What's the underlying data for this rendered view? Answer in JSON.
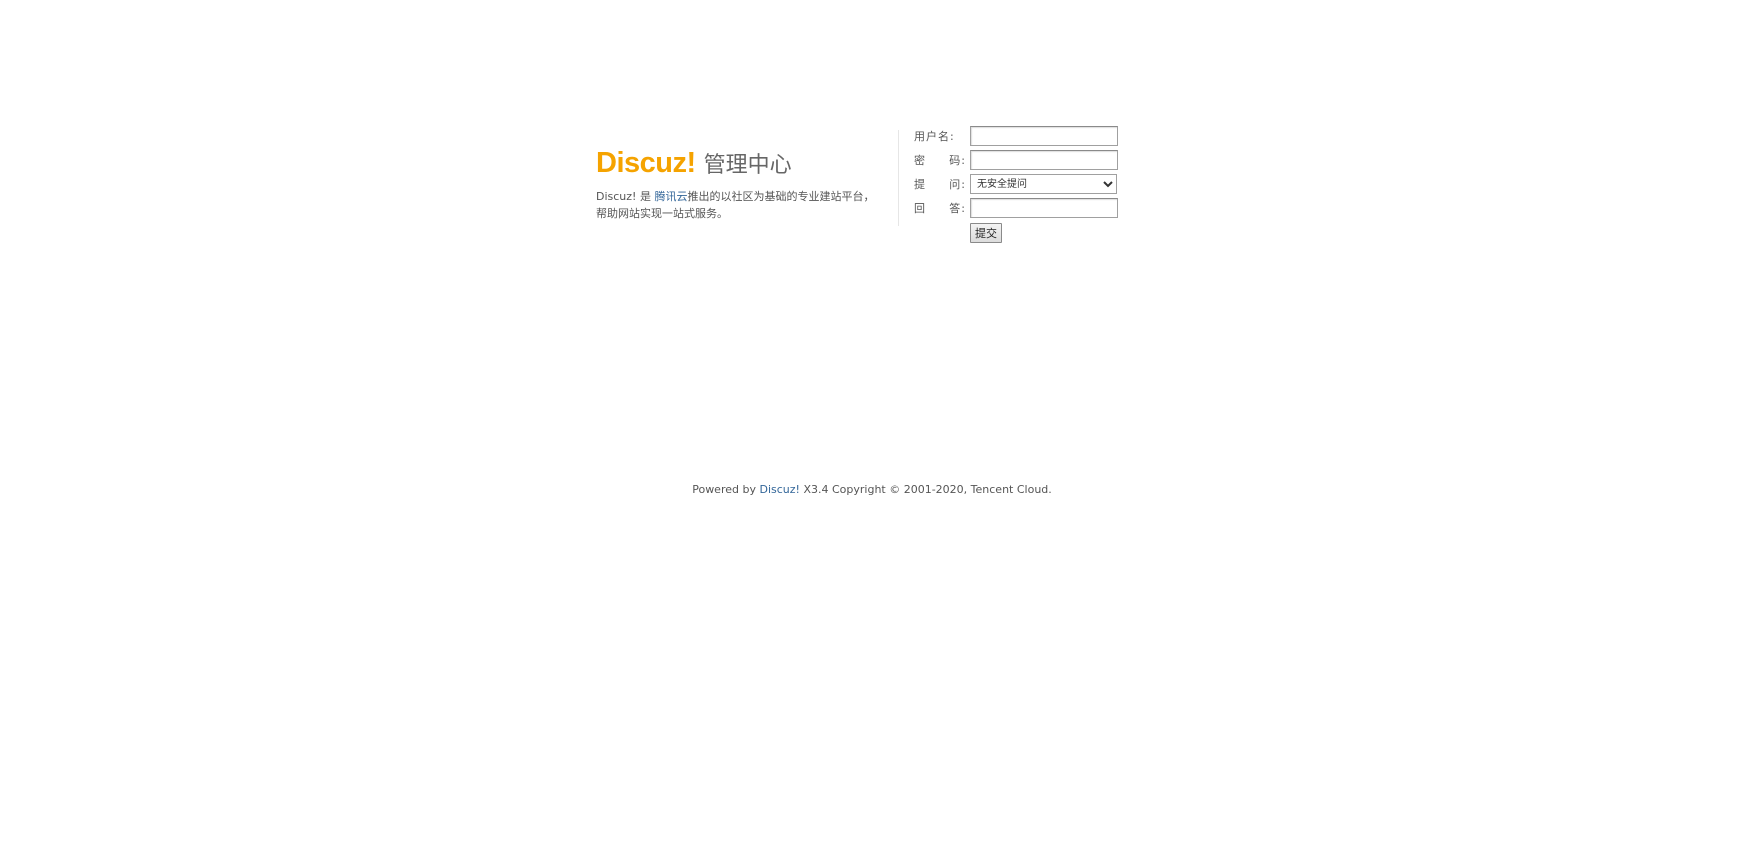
{
  "brand": {
    "logo_text": "Discuz!",
    "subtitle": "管理中心",
    "intro_prefix": "Discuz! 是 ",
    "intro_link": "腾讯云",
    "intro_suffix_line1": "推出的以社区为基础的专业建站平台，",
    "intro_line2": "帮助网站实现一站式服务。",
    "logo_color": "#f5a300",
    "link_color": "#336699"
  },
  "login_form": {
    "username_label": "用户名:",
    "password_label_a": "密",
    "password_label_b": "码:",
    "question_label_a": "提",
    "question_label_b": "问:",
    "answer_label_a": "回",
    "answer_label_b": "答:",
    "username_value": "",
    "password_value": "",
    "question_selected": "无安全提问",
    "answer_value": "",
    "submit_label": "提交"
  },
  "footer": {
    "prefix": "Powered by ",
    "link": "Discuz!",
    "suffix": " X3.4 Copyright © 2001-2020, Tencent Cloud."
  }
}
